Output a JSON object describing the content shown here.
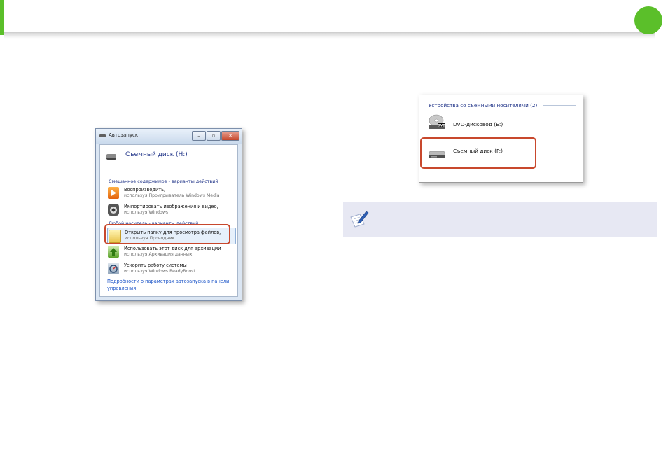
{
  "colors": {
    "accent": "#5bbf2a",
    "highlight": "#c8482d",
    "link": "#1c55c8",
    "heading": "#1e3287",
    "note_bg": "#e7e8f3"
  },
  "autoplay": {
    "title": "Автозапуск",
    "device": "Съемный диск (H:)",
    "group1": "Смешанное содержимое - варианты действий",
    "group2": "Любой носитель - варианты действий",
    "items": [
      {
        "line1": "Воспроизводить,",
        "line2": "используя Проигрыватель Windows Media",
        "icon": "media-player-icon"
      },
      {
        "line1": "Импортировать изображения и видео,",
        "line2": "используя Windows",
        "icon": "camera-import-icon"
      },
      {
        "line1": "Открыть папку для просмотра файлов,",
        "line2": "используя Проводник",
        "icon": "folder-icon"
      },
      {
        "line1": "Использовать этот диск для архивации",
        "line2": "используя Архивация данных",
        "icon": "backup-icon"
      },
      {
        "line1": "Ускорить работу системы",
        "line2": "используя Windows ReadyBoost",
        "icon": "readyboost-icon"
      }
    ],
    "link": "Подробности о параметрах автозапуска в панели управления"
  },
  "devices": {
    "heading": "Устройства со съемными носителями (2)",
    "items": [
      {
        "label": "DVD-дисковод (E:)",
        "icon": "dvd-drive-icon"
      },
      {
        "label": "Съемный диск (F:)",
        "icon": "removable-disk-icon"
      }
    ]
  },
  "note": {
    "icon": "note-pencil-icon"
  }
}
